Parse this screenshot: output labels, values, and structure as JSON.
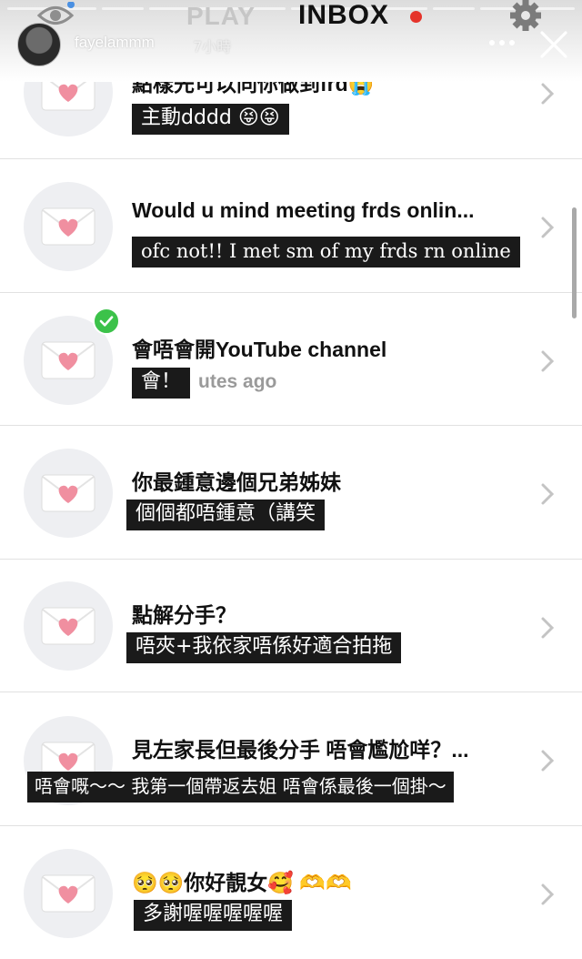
{
  "header": {
    "tab_play": "PLAY",
    "tab_inbox": "INBOX",
    "username": "fayelammm",
    "posted_time": "7小時",
    "icons": [
      "eye-icon",
      "gear-icon",
      "more-icon",
      "close-icon"
    ],
    "accent_color": "#e5332a"
  },
  "inbox": [
    {
      "question": "點樣先可以同你做到frd😭",
      "answer": "主動dddd 😝😝",
      "answer_style": "sans",
      "checked": false
    },
    {
      "question": "Would u mind meeting frds onlin...",
      "answer": "ofc not!! I met sm of my frds rn online",
      "answer_style": "serif",
      "checked": false
    },
    {
      "question": "會唔會開YouTube channel",
      "answer": "會！",
      "answer_style": "sans",
      "subtext": "utes ago",
      "checked": true
    },
    {
      "question": "你最鍾意邊個兄弟姊妹",
      "answer": "個個都唔鍾意（講笑",
      "answer_style": "sans",
      "checked": false
    },
    {
      "question": "點解分手？",
      "answer": "唔夾+我依家唔係好適合拍拖",
      "answer_style": "sans",
      "checked": false
    },
    {
      "question": "見左家長但最後分手 唔會尷尬咩？...",
      "answer": "唔會嘅～～ 我第一個帶返去姐 唔會係最後一個掛～",
      "answer_style": "sans",
      "checked": false
    },
    {
      "question": "🥺🥺你好靚女🥰 🫶🫶",
      "answer": "多謝喔喔喔喔喔",
      "answer_style": "sans",
      "checked": false
    }
  ],
  "colors": {
    "envelope_heart": "#f08fa0",
    "check_green": "#3cc24a",
    "highlight_bg": "#1a1a1a"
  }
}
